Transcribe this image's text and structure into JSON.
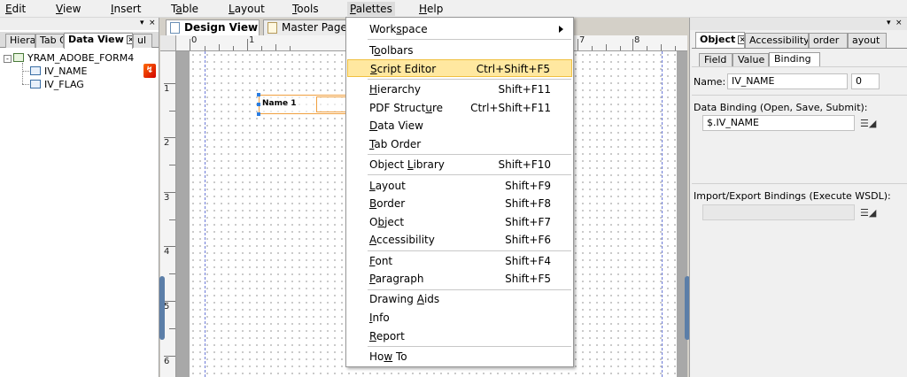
{
  "menubar": {
    "items": [
      {
        "id": "edit",
        "pre": "",
        "u": "E",
        "post": "dit"
      },
      {
        "id": "view",
        "pre": "",
        "u": "V",
        "post": "iew"
      },
      {
        "id": "insert",
        "pre": "",
        "u": "I",
        "post": "nsert"
      },
      {
        "id": "table",
        "pre": "T",
        "u": "a",
        "post": "ble"
      },
      {
        "id": "layout",
        "pre": "",
        "u": "L",
        "post": "ayout"
      },
      {
        "id": "tools",
        "pre": "",
        "u": "T",
        "post": "ools"
      },
      {
        "id": "palettes",
        "pre": "",
        "u": "P",
        "post": "alettes"
      },
      {
        "id": "help",
        "pre": "",
        "u": "H",
        "post": "elp"
      }
    ]
  },
  "left_panel": {
    "controls": {
      "pin": "▾",
      "close": "×"
    },
    "tabs": [
      "Hiera",
      "Tab O",
      "Data View",
      "ul"
    ],
    "tab_close": "×",
    "tree": {
      "root": {
        "expander": "-",
        "label": "YRAM_ADOBE_FORM4"
      },
      "children": [
        "IV_NAME",
        "IV_FLAG"
      ]
    }
  },
  "doc_tabs": [
    "Design View",
    "Master Page"
  ],
  "ruler": {
    "top_labels": [
      "0",
      "1",
      "7",
      "8"
    ],
    "left_labels": [
      "1",
      "2",
      "3",
      "4",
      "5",
      "6"
    ]
  },
  "canvas": {
    "field_caption": "Name 1"
  },
  "menu": {
    "items": [
      {
        "id": "workspace",
        "pre": "Work",
        "u": "s",
        "post": "pace",
        "shortcut": "",
        "submenu": true
      },
      {
        "id": "toolbars",
        "pre": "T",
        "u": "o",
        "post": "olbars",
        "shortcut": ""
      },
      {
        "id": "script-editor",
        "pre": "",
        "u": "S",
        "post": "cript Editor",
        "shortcut": "Ctrl+Shift+F5",
        "highlight": true
      },
      {
        "id": "hierarchy",
        "pre": "",
        "u": "H",
        "post": "ierarchy",
        "shortcut": "Shift+F11"
      },
      {
        "id": "pdf-structure",
        "pre": "PDF Struct",
        "u": "u",
        "post": "re",
        "shortcut": "Ctrl+Shift+F11"
      },
      {
        "id": "data-view",
        "pre": "",
        "u": "D",
        "post": "ata View",
        "shortcut": ""
      },
      {
        "id": "tab-order",
        "pre": "",
        "u": "T",
        "post": "ab Order",
        "shortcut": ""
      },
      {
        "id": "object-library",
        "pre": "Object ",
        "u": "L",
        "post": "ibrary",
        "shortcut": "Shift+F10"
      },
      {
        "id": "layout",
        "pre": "",
        "u": "L",
        "post": "ayout",
        "shortcut": "Shift+F9"
      },
      {
        "id": "border",
        "pre": "",
        "u": "B",
        "post": "order",
        "shortcut": "Shift+F8"
      },
      {
        "id": "object",
        "pre": "O",
        "u": "b",
        "post": "ject",
        "shortcut": "Shift+F7"
      },
      {
        "id": "accessibility",
        "pre": "",
        "u": "A",
        "post": "ccessibility",
        "shortcut": "Shift+F6"
      },
      {
        "id": "font",
        "pre": "",
        "u": "F",
        "post": "ont",
        "shortcut": "Shift+F4"
      },
      {
        "id": "paragraph",
        "pre": "",
        "u": "P",
        "post": "aragraph",
        "shortcut": "Shift+F5"
      },
      {
        "id": "drawing-aids",
        "pre": "Drawing ",
        "u": "A",
        "post": "ids",
        "shortcut": ""
      },
      {
        "id": "info",
        "pre": "",
        "u": "I",
        "post": "nfo",
        "shortcut": ""
      },
      {
        "id": "report",
        "pre": "",
        "u": "R",
        "post": "eport",
        "shortcut": ""
      },
      {
        "id": "how-to",
        "pre": "Ho",
        "u": "w",
        "post": " To",
        "shortcut": ""
      }
    ]
  },
  "right_panel": {
    "controls": {
      "pin": "▾",
      "close": "×"
    },
    "tabs": [
      "Object",
      "Accessibility",
      "order",
      "ayout"
    ],
    "tab_close": "×",
    "sub_tabs": [
      "Field",
      "Value",
      "Binding"
    ],
    "name_label": "Name:",
    "name_value": "IV_NAME",
    "name_index": "0",
    "data_binding_label": "Data Binding (Open, Save, Submit):",
    "data_binding_value": "$.IV_NAME",
    "import_export_label": "Import/Export Bindings (Execute WSDL):",
    "import_export_value": "",
    "list_icon_glyph": "☰◢"
  }
}
